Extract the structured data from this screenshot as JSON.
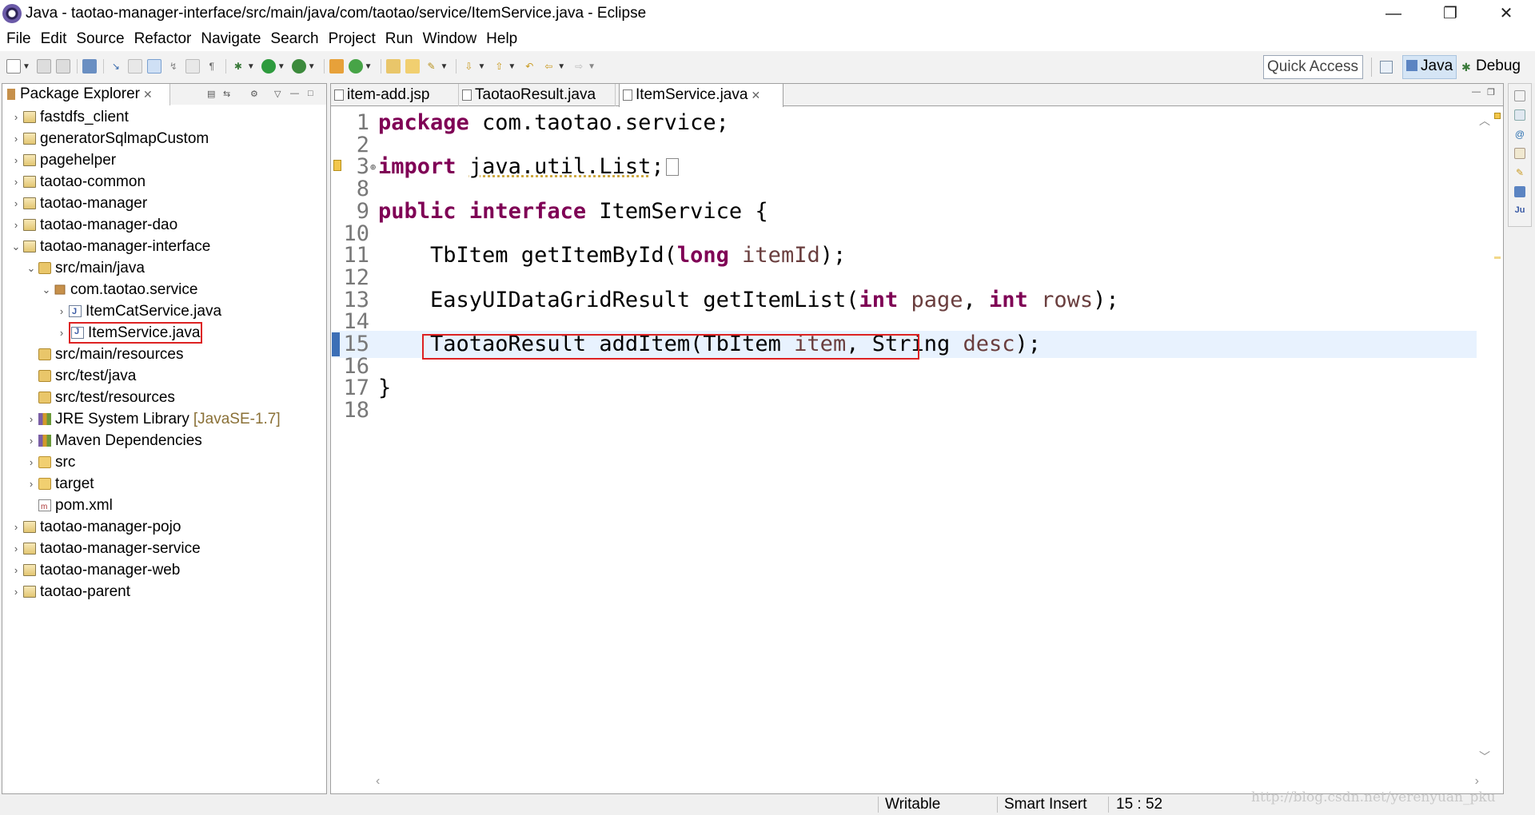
{
  "window": {
    "title": "Java - taotao-manager-interface/src/main/java/com/taotao/service/ItemService.java - Eclipse",
    "minimize_glyph": "—",
    "restore_glyph": "❐",
    "close_glyph": "✕"
  },
  "menu": [
    "File",
    "Edit",
    "Source",
    "Refactor",
    "Navigate",
    "Search",
    "Project",
    "Run",
    "Window",
    "Help"
  ],
  "toolbar": {
    "quick_access_placeholder": "Quick Access",
    "perspectives": {
      "java": "Java",
      "debug": "Debug"
    }
  },
  "package_explorer": {
    "title": "Package Explorer",
    "items": [
      {
        "label": "fastdfs_client",
        "type": "project",
        "depth": 0,
        "expanded": false
      },
      {
        "label": "generatorSqlmapCustom",
        "type": "project",
        "depth": 0,
        "expanded": false
      },
      {
        "label": "pagehelper",
        "type": "project",
        "depth": 0,
        "expanded": false
      },
      {
        "label": "taotao-common",
        "type": "project",
        "depth": 0,
        "expanded": false
      },
      {
        "label": "taotao-manager",
        "type": "project",
        "depth": 0,
        "expanded": false
      },
      {
        "label": "taotao-manager-dao",
        "type": "project",
        "depth": 0,
        "expanded": false
      },
      {
        "label": "taotao-manager-interface",
        "type": "project",
        "depth": 0,
        "expanded": true
      },
      {
        "label": "src/main/java",
        "type": "srcfolder",
        "depth": 1,
        "expanded": true
      },
      {
        "label": "com.taotao.service",
        "type": "package",
        "depth": 2,
        "expanded": true
      },
      {
        "label": "ItemCatService.java",
        "type": "java",
        "depth": 3,
        "expanded": false
      },
      {
        "label": "ItemService.java",
        "type": "java",
        "depth": 3,
        "expanded": false,
        "highlighted": true
      },
      {
        "label": "src/main/resources",
        "type": "srcfolder",
        "depth": 1,
        "leaf": true
      },
      {
        "label": "src/test/java",
        "type": "srcfolder",
        "depth": 1,
        "leaf": true
      },
      {
        "label": "src/test/resources",
        "type": "srcfolder",
        "depth": 1,
        "leaf": true
      },
      {
        "label": "JRE System Library",
        "decoration": "[JavaSE-1.7]",
        "type": "lib",
        "depth": 1,
        "expanded": false
      },
      {
        "label": "Maven Dependencies",
        "type": "lib",
        "depth": 1,
        "expanded": false
      },
      {
        "label": "src",
        "type": "folder",
        "depth": 1,
        "expanded": false
      },
      {
        "label": "target",
        "type": "folder",
        "depth": 1,
        "expanded": false
      },
      {
        "label": "pom.xml",
        "type": "xml",
        "depth": 1,
        "leaf": true
      },
      {
        "label": "taotao-manager-pojo",
        "type": "project",
        "depth": 0,
        "expanded": false
      },
      {
        "label": "taotao-manager-service",
        "type": "project",
        "depth": 0,
        "expanded": false
      },
      {
        "label": "taotao-manager-web",
        "type": "project",
        "depth": 0,
        "expanded": false
      },
      {
        "label": "taotao-parent",
        "type": "project",
        "depth": 0,
        "expanded": false
      }
    ]
  },
  "editor": {
    "tabs": [
      {
        "label": "item-add.jsp",
        "active": false
      },
      {
        "label": "TaotaoResult.java",
        "active": false
      },
      {
        "label": "ItemService.java",
        "active": true
      }
    ],
    "current_line": "15",
    "lines": [
      {
        "n": "1",
        "tokens": [
          [
            "kw",
            "package"
          ],
          [
            "t",
            " com.taotao.service;"
          ]
        ]
      },
      {
        "n": "2",
        "tokens": []
      },
      {
        "n": "3",
        "tokens": [
          [
            "kw",
            "import"
          ],
          [
            "t",
            " "
          ],
          [
            "u",
            "java.util.List"
          ],
          [
            "t",
            ";"
          ]
        ],
        "folded": true,
        "warning": true
      },
      {
        "n": "8",
        "tokens": []
      },
      {
        "n": "9",
        "tokens": [
          [
            "kw",
            "public"
          ],
          [
            "t",
            " "
          ],
          [
            "kw",
            "interface"
          ],
          [
            "t",
            " ItemService {"
          ]
        ]
      },
      {
        "n": "10",
        "tokens": []
      },
      {
        "n": "11",
        "tokens": [
          [
            "t",
            "    TbItem getItemById("
          ],
          [
            "kw",
            "long"
          ],
          [
            "t",
            " "
          ],
          [
            "p",
            "itemId"
          ],
          [
            "t",
            ");"
          ]
        ]
      },
      {
        "n": "12",
        "tokens": []
      },
      {
        "n": "13",
        "tokens": [
          [
            "t",
            "    EasyUIDataGridResult getItemList("
          ],
          [
            "kw",
            "int"
          ],
          [
            "t",
            " "
          ],
          [
            "p",
            "page"
          ],
          [
            "t",
            ", "
          ],
          [
            "kw",
            "int"
          ],
          [
            "t",
            " "
          ],
          [
            "p",
            "rows"
          ],
          [
            "t",
            ");"
          ]
        ]
      },
      {
        "n": "14",
        "tokens": []
      },
      {
        "n": "15",
        "tokens": [
          [
            "t",
            "    TaotaoResult addItem(TbItem "
          ],
          [
            "p",
            "item"
          ],
          [
            "t",
            ", String "
          ],
          [
            "p",
            "desc"
          ],
          [
            "t",
            ");"
          ]
        ],
        "current": true,
        "highlighted": true
      },
      {
        "n": "16",
        "tokens": []
      },
      {
        "n": "17",
        "tokens": [
          [
            "t",
            "}"
          ]
        ]
      },
      {
        "n": "18",
        "tokens": []
      }
    ]
  },
  "status": {
    "writable": "Writable",
    "insert_mode": "Smart Insert",
    "position": "15 : 52"
  },
  "watermark": "http://blog.csdn.net/yerenyuan_pku",
  "colors": {
    "keyword": "#7f0055",
    "parameter": "#6a3e3e",
    "current_line": "#e8f2fe",
    "highlight_box": "#dd2222"
  }
}
